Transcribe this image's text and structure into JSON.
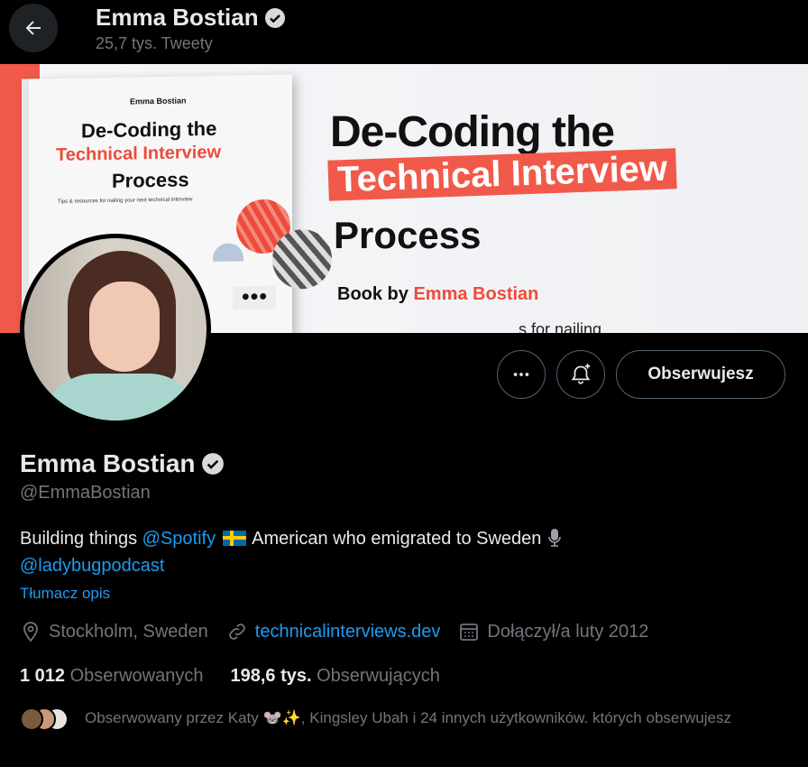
{
  "header": {
    "back_icon": "arrow-left-icon",
    "name": "Emma Bostian",
    "tweet_count": "25,7 tys. Tweety"
  },
  "banner": {
    "book_author": "Emma Bostian",
    "book_title_1": "De-Coding the",
    "book_title_2": "Technical Interview",
    "book_title_3": "Process",
    "book_tips": "Tips & resources for nailing your next technical interview",
    "big_title_1": "De-Coding the",
    "big_title_2": "Technical Interview",
    "big_title_3": "Process",
    "by_prefix": "Book by ",
    "by_name": "Emma Bostian",
    "cut_text": "...s for nailing",
    "accent_color": "#f15a4a"
  },
  "actions": {
    "more_icon": "more-dots-icon",
    "notify_icon": "bell-plus-icon",
    "follow_label": "Obserwujesz"
  },
  "profile": {
    "name": "Emma Bostian",
    "verified_icon": "verified-badge-icon",
    "handle": "@EmmaBostian",
    "bio_1": "Building things ",
    "bio_link_1": "@Spotify",
    "bio_2": " American who emigrated to Sweden ",
    "bio_link_2": "@ladybugpodcast",
    "translate": "Tłumacz opis",
    "location": "Stockholm, Sweden",
    "website": "technicalinterviews.dev",
    "joined": "Dołączył/a luty 2012",
    "following_count": "1 012",
    "following_label": "Obserwowanych",
    "followers_count": "198,6 tys.",
    "followers_label": "Obserwujących",
    "followed_by": "Obserwowany przez Katy 🐭✨, Kingsley Ubah i 24 innych użytkowników. których obserwujesz"
  }
}
